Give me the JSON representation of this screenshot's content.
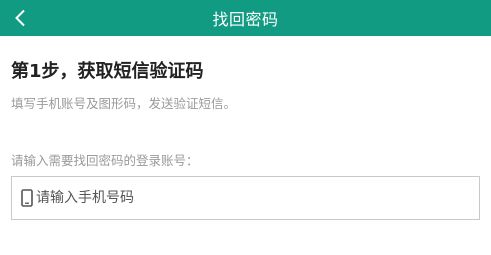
{
  "header": {
    "title": "找回密码",
    "back_icon": "chevron-left-icon",
    "background_color": "#119b83"
  },
  "step": {
    "title": "第1步，获取短信验证码",
    "description": "填写手机账号及图形码，发送验证短信。"
  },
  "account": {
    "label": "请输入需要找回密码的登录账号：",
    "phone_icon": "mobile-phone-icon",
    "phone_placeholder": "请输入手机号码",
    "phone_value": ""
  }
}
